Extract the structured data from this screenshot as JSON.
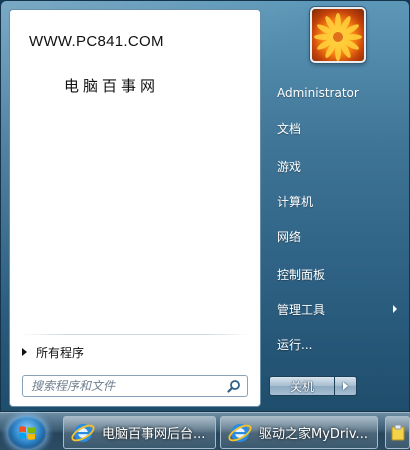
{
  "left_pane": {
    "brand_url": "WWW.PC841.COM",
    "brand_name": "电脑百事网",
    "all_programs": "所有程序",
    "search_placeholder": "搜索程序和文件"
  },
  "right_pane": {
    "items": [
      {
        "label": "Administrator",
        "has_submenu": false
      },
      {
        "label": "文档",
        "has_submenu": false
      },
      {
        "label": "游戏",
        "has_submenu": false
      },
      {
        "label": "计算机",
        "has_submenu": false
      },
      {
        "label": "网络",
        "has_submenu": false
      },
      {
        "label": "控制面板",
        "has_submenu": false
      },
      {
        "label": "管理工具",
        "has_submenu": true
      },
      {
        "label": "运行...",
        "has_submenu": false
      }
    ],
    "shutdown_label": "关机"
  },
  "taskbar": {
    "buttons": [
      {
        "label": "电脑百事网后台...",
        "icon": "internet-explorer-icon"
      },
      {
        "label": "驱动之家MyDriv...",
        "icon": "internet-explorer-icon"
      }
    ]
  },
  "colors": {
    "accent": "#2c5f81",
    "pane_bg": "#ffffff",
    "taskbar": "#2b4c63"
  }
}
